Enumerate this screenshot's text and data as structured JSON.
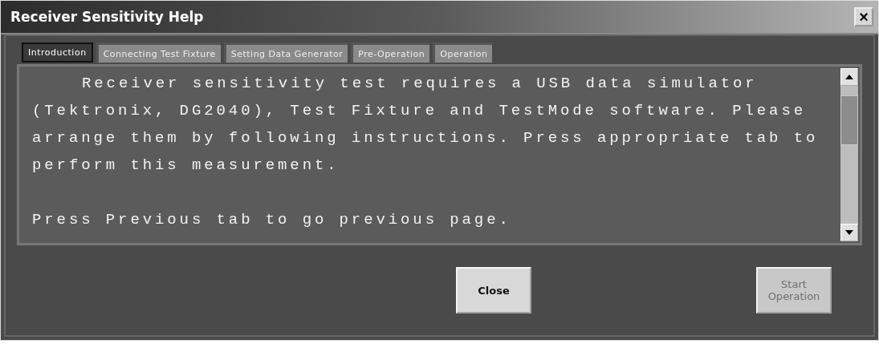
{
  "window": {
    "title": "Receiver Sensitivity Help",
    "close": "×"
  },
  "tabs": [
    {
      "label": "Introduction",
      "selected": true
    },
    {
      "label": "Connecting Test Fixture",
      "selected": false
    },
    {
      "label": "Setting Data Generator",
      "selected": false
    },
    {
      "label": "Pre-Operation",
      "selected": false
    },
    {
      "label": "Operation",
      "selected": false
    }
  ],
  "content": {
    "paragraphs": [
      "Receiver sensitivity test requires a USB data simulator (Tektronix, DG2040), Test Fixture and TestMode software. Please arrange them by following instructions. Press appropriate tab to perform this measurement.",
      "Press Previous tab to go previous page."
    ]
  },
  "buttons": [
    {
      "label": "Close",
      "disabled": false
    },
    {
      "label": "Start Operation",
      "disabled": true
    }
  ]
}
